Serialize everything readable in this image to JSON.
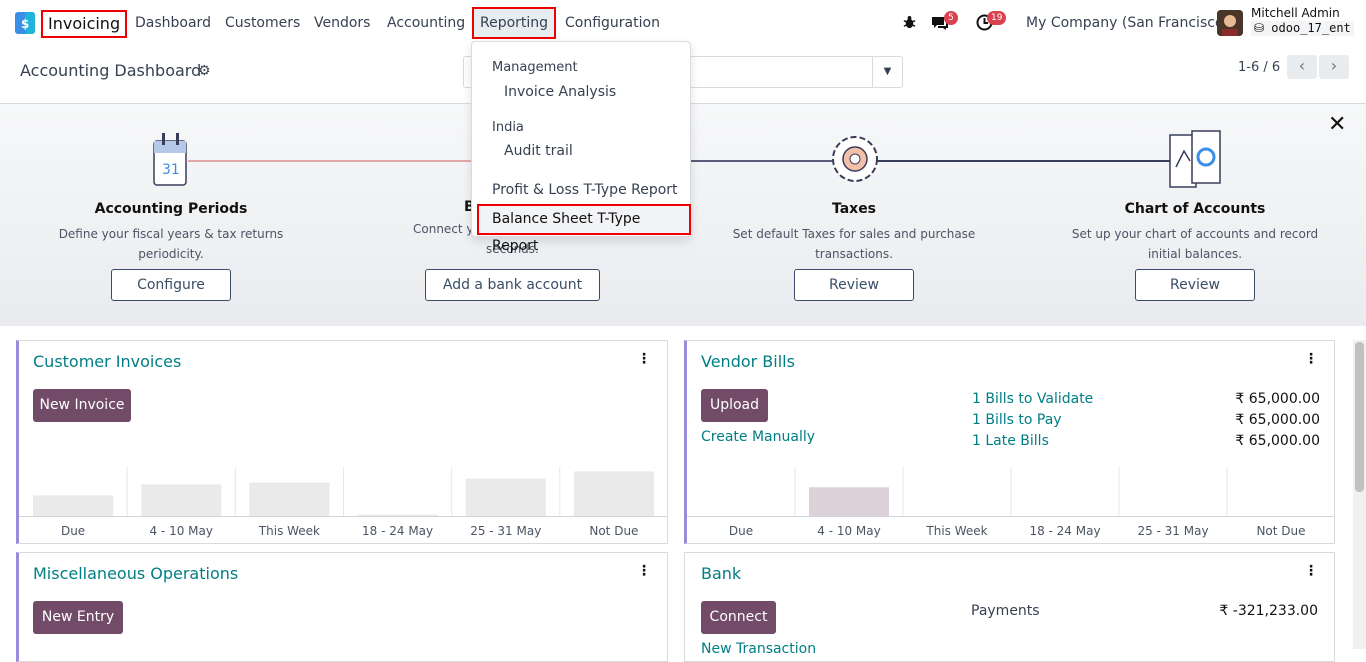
{
  "nav": {
    "app": "Invoicing",
    "menus": [
      "Dashboard",
      "Customers",
      "Vendors",
      "Accounting",
      "Reporting",
      "Configuration"
    ],
    "chat_badge": "5",
    "activity_badge": "19",
    "company": "My Company (San Francisco)",
    "user": "Mitchell Admin",
    "database": "odoo_17_ent"
  },
  "control_panel": {
    "title": "Accounting Dashboard",
    "pager": "1-6 / 6"
  },
  "reporting_menu": {
    "sections": [
      {
        "heading": "Management",
        "items": [
          "Invoice Analysis"
        ]
      },
      {
        "heading": "India",
        "items": [
          "Audit trail"
        ]
      }
    ],
    "items": [
      "Profit & Loss T-Type Report",
      "Balance Sheet T-Type Report"
    ]
  },
  "onboarding": {
    "steps": [
      {
        "title": "Accounting Periods",
        "desc": "Define your fiscal years & tax returns periodicity.",
        "button": "Configure",
        "icon": "calendar-icon"
      },
      {
        "title": "B",
        "desc": "Connect y… seconds.",
        "button": "Add a bank account",
        "icon": "bank-icon"
      },
      {
        "title": "Taxes",
        "desc": "Set default Taxes for sales and purchase transactions.",
        "button": "Review",
        "icon": "gear-cog-icon"
      },
      {
        "title": "Chart of Accounts",
        "desc": "Set up your chart of accounts and record initial balances.",
        "button": "Review",
        "icon": "chart-accounts-icon"
      }
    ]
  },
  "journals": {
    "customer_invoices": {
      "title": "Customer Invoices",
      "button": "New Invoice",
      "chart_categories": [
        "Due",
        "4 - 10 May",
        "This Week",
        "18 - 24 May",
        "25 - 31 May",
        "Not Due"
      ],
      "chart_values": [
        0.45,
        0.68,
        0.72,
        0.05,
        0.8,
        0.95
      ]
    },
    "vendor_bills": {
      "title": "Vendor Bills",
      "button": "Upload",
      "secondary": "Create Manually",
      "stats": [
        {
          "label": "1 Bills to Validate",
          "value": "₹ 65,000.00"
        },
        {
          "label": "1 Bills to Pay",
          "value": "₹ 65,000.00"
        },
        {
          "label": "1 Late Bills",
          "value": "₹ 65,000.00"
        }
      ],
      "chart_categories": [
        "Due",
        "4 - 10 May",
        "This Week",
        "18 - 24 May",
        "25 - 31 May",
        "Not Due"
      ],
      "chart_values": [
        0,
        0.62,
        0,
        0,
        0,
        0
      ]
    },
    "misc": {
      "title": "Miscellaneous Operations",
      "button": "New Entry"
    },
    "bank": {
      "title": "Bank",
      "button": "Connect",
      "secondary": "New Transaction",
      "stat_label": "Payments",
      "stat_value": "₹ -321,233.00"
    }
  }
}
